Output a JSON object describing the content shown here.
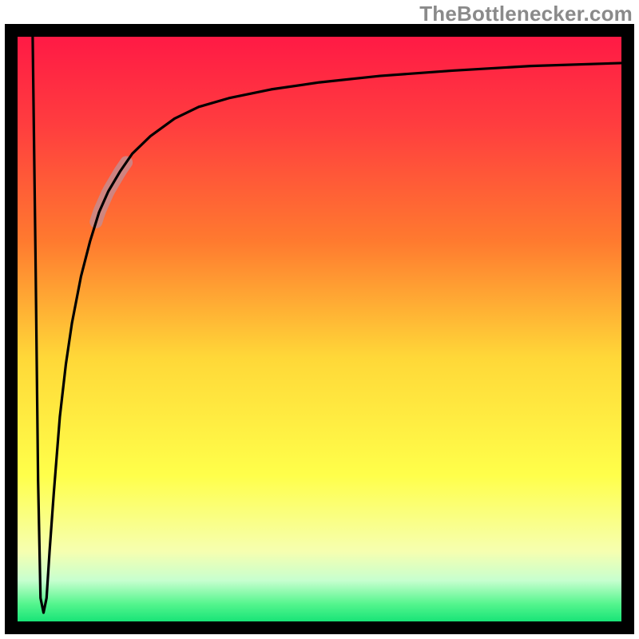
{
  "watermark": {
    "text": "TheBottlenecker.com"
  },
  "colors": {
    "frame": "#000000",
    "curve": "#000000",
    "highlight": "#c78b8d",
    "gradient_stops": [
      {
        "offset": 0.0,
        "color": "#ff1a45"
      },
      {
        "offset": 0.15,
        "color": "#ff3d3f"
      },
      {
        "offset": 0.35,
        "color": "#ff7a2f"
      },
      {
        "offset": 0.55,
        "color": "#ffd838"
      },
      {
        "offset": 0.75,
        "color": "#ffff4a"
      },
      {
        "offset": 0.88,
        "color": "#f6ffb0"
      },
      {
        "offset": 0.93,
        "color": "#c7ffcf"
      },
      {
        "offset": 0.97,
        "color": "#55f58e"
      },
      {
        "offset": 1.0,
        "color": "#18e477"
      }
    ]
  },
  "chart_data": {
    "type": "line",
    "title": "",
    "xlabel": "",
    "ylabel": "",
    "xlim": [
      0,
      100
    ],
    "ylim": [
      0,
      100
    ],
    "grid": false,
    "legend": false,
    "series": [
      {
        "name": "bottleneck-curve",
        "x": [
          2.5,
          3.0,
          3.4,
          3.8,
          4.3,
          4.8,
          5.3,
          6.0,
          7.0,
          8.0,
          9.0,
          10.5,
          12.0,
          13.5,
          15.0,
          17.0,
          19.0,
          22.0,
          26.0,
          30.0,
          35.0,
          42.0,
          50.0,
          60.0,
          72.0,
          85.0,
          100.0
        ],
        "y": [
          100.0,
          60.0,
          24.0,
          4.0,
          1.5,
          4.0,
          12.0,
          22.0,
          35.0,
          44.0,
          51.0,
          59.0,
          65.0,
          70.0,
          73.5,
          77.0,
          80.0,
          83.0,
          86.0,
          88.0,
          89.5,
          91.0,
          92.2,
          93.3,
          94.2,
          95.0,
          95.5
        ]
      }
    ],
    "highlight_segment": {
      "series": "bottleneck-curve",
      "x_range": [
        13.0,
        18.0
      ],
      "note": "pink overlay on curve"
    }
  }
}
